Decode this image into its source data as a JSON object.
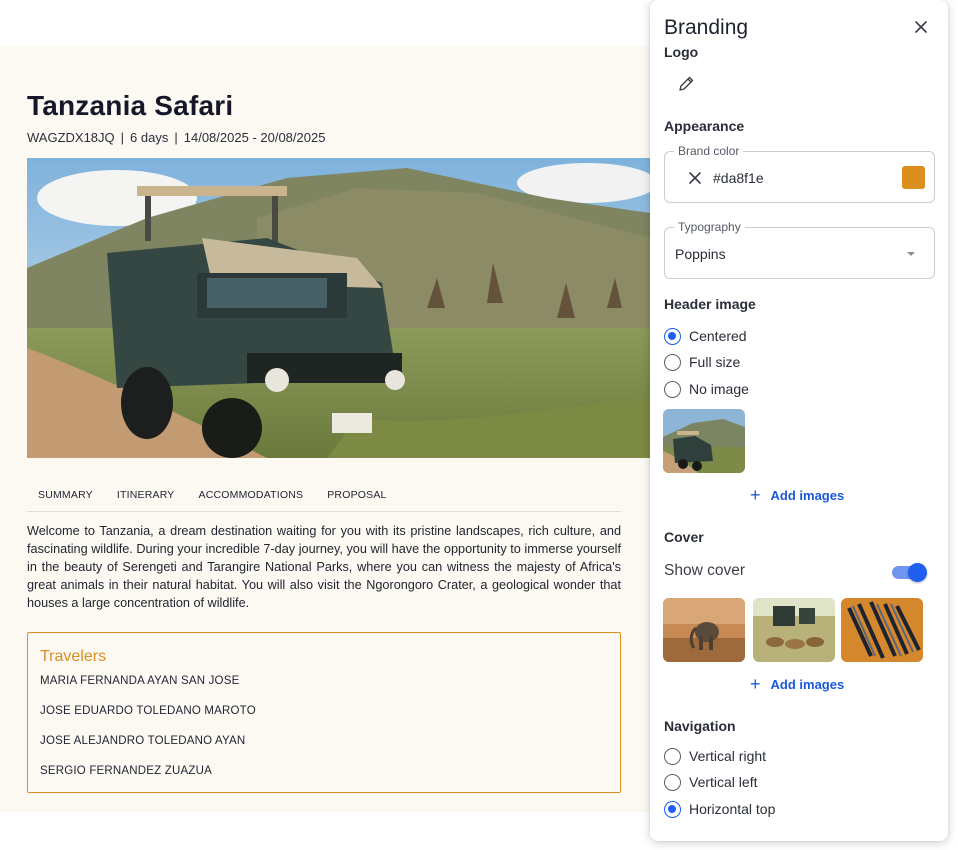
{
  "proposal": {
    "title": "Tanzania Safari",
    "code": "WAGZDX18JQ",
    "duration": "6 days",
    "dates": "14/08/2025 - 20/08/2025",
    "meta_separator": "|",
    "tabs": [
      "SUMMARY",
      "ITINERARY",
      "ACCOMMODATIONS",
      "PROPOSAL"
    ],
    "summary": "Welcome to Tanzania, a dream destination waiting for you with its pristine landscapes, rich culture, and fascinating wildlife. During your incredible 7-day journey, you will have the opportunity to immerse yourself in the beauty of Serengeti and Tarangire National Parks, where you can witness the majesty of Africa's great animals in their natural habitat. You will also visit the Ngorongoro Crater, a geological wonder that houses a large concentration of wildlife.",
    "travelers_title": "Travelers",
    "travelers": [
      "MARIA FERNANDA AYAN SAN JOSE",
      "JOSE EDUARDO TOLEDANO MAROTO",
      "JOSE ALEJANDRO TOLEDANO AYAN",
      "SERGIO FERNANDEZ ZUAZUA"
    ]
  },
  "branding": {
    "title": "Branding",
    "logo_label": "Logo",
    "appearance_label": "Appearance",
    "brand_color_legend": "Brand color",
    "brand_color_value": "#da8f1e",
    "brand_color": "#da8f1e",
    "typography_legend": "Typography",
    "typography_value": "Poppins",
    "header_image_label": "Header image",
    "header_image_options": [
      "Centered",
      "Full size",
      "No image"
    ],
    "header_image_selected": "Centered",
    "add_images_label": "Add images",
    "cover_label": "Cover",
    "show_cover_label": "Show cover",
    "show_cover_enabled": true,
    "navigation_label": "Navigation",
    "navigation_options": [
      "Vertical right",
      "Vertical left",
      "Horizontal top"
    ],
    "navigation_selected": "Horizontal top"
  },
  "colors": {
    "accent_blue": "#1e5ef0",
    "brand_orange": "#da8f1e",
    "preview_background": "#fcf9f3"
  }
}
